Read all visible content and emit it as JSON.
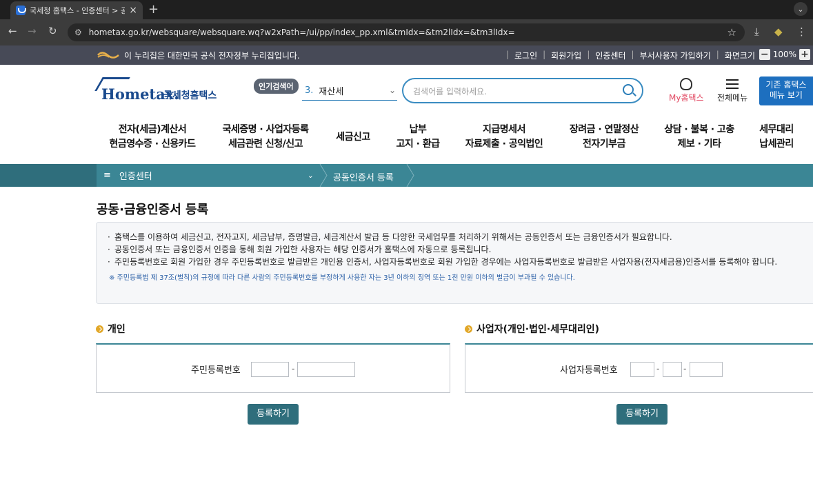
{
  "browser": {
    "tab_title": "국세청 홈택스 - 인증센터 > 공동인",
    "tab_close": "×",
    "new_tab": "+",
    "url": "hometax.go.kr/websquare/websquare.wq?w2xPath=/ui/pp/index_pp.xml&tmIdx=&tm2lIdx=&tm3lIdx="
  },
  "gov_banner": {
    "text": "이 누리집은 대한민국 공식 전자정부 누리집입니다.",
    "links": [
      "로그인",
      "회원가입",
      "인증센터",
      "부서사용자 가입하기",
      "화면크기"
    ],
    "zoom_minus": "−",
    "zoom_level": "100%",
    "zoom_plus": "+"
  },
  "header": {
    "logo_word": "Hometax.",
    "logo_ko": "국세청홈택스",
    "popular_label": "인기검색어",
    "popular_rank": "3.",
    "popular_term": "재산세",
    "search_placeholder": "검색어를 입력하세요.",
    "my_hometax": "My홈택스",
    "all_menu": "전체메뉴",
    "old_menu_line1": "기존 홈택스",
    "old_menu_line2": "메뉴 보기"
  },
  "gnb": [
    {
      "l1": "전자(세금)계산서",
      "l2": "현금영수증 · 신용카드"
    },
    {
      "l1": "국세증명 · 사업자등록",
      "l2": "세금관련 신청/신고"
    },
    {
      "l1": "세금신고",
      "l2": ""
    },
    {
      "l1": "납부",
      "l2": "고지 · 환급"
    },
    {
      "l1": "지급명세서",
      "l2": "자료제출 · 공익법인"
    },
    {
      "l1": "장려금 · 연말정산",
      "l2": "전자기부금"
    },
    {
      "l1": "상담 · 불복 · 고충",
      "l2": "제보 · 기타"
    },
    {
      "l1": "세무대리",
      "l2": "납세관리"
    }
  ],
  "breadcrumb": {
    "menu_icon": "≡",
    "first": "인증센터",
    "second": "공동인증서 등록"
  },
  "page": {
    "title": "공동·금융인증서 등록",
    "notices": [
      "홈택스를 이용하여 세금신고, 전자고지, 세금납부, 증명발급, 세금계산서 발급 등 다양한 국세업무를 처리하기 위해서는 공동인증서 또는 금융인증서가 필요합니다.",
      "공동인증서 또는 금융인증서 인증을 통해 회원 가입한 사용자는 해당 인증서가 홈택스에 자동으로 등록됩니다.",
      "주민등록번호로 회원 가입한 경우 주민등록번호로 발급받은 개인용 인증서, 사업자등록번호로 회원 가입한 경우에는 사업자등록번호로 발급받은 사업자용(전자세금용)인증서를 등록해야 합니다."
    ],
    "warning": "※ 주민등록법 제 37조(벌칙)의 규정에 따라 다른 사람의 주민등록번호를 부정하게 사용한 자는 3년 이하의 징역 또는 1천 만원 이하의 벌금이 부과될 수 있습니다."
  },
  "personal": {
    "heading": "개인",
    "label": "주민등록번호",
    "dash": "-",
    "button": "등록하기"
  },
  "business": {
    "heading": "사업자(개인·법인·세무대리인)",
    "label": "사업자등록번호",
    "dash": "-",
    "button": "등록하기"
  }
}
